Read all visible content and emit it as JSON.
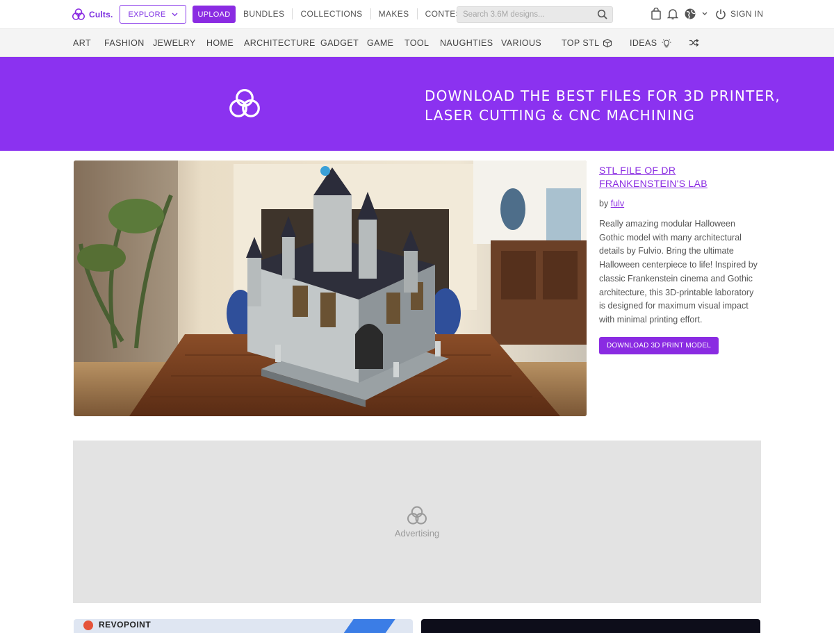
{
  "brand": {
    "logo_text": "Cults.",
    "accent": "#8a2be2"
  },
  "header": {
    "explore_label": "EXPLORE",
    "upload_label": "UPLOAD",
    "nav": [
      "BUNDLES",
      "COLLECTIONS",
      "MAKES",
      "CONTEST"
    ],
    "search_placeholder": "Search 3.6M designs...",
    "signin_label": "SIGN IN"
  },
  "categories": [
    "ART",
    "FASHION",
    "JEWELRY",
    "HOME",
    "ARCHITECTURE",
    "GADGET",
    "GAME",
    "TOOL",
    "NAUGHTIES",
    "VARIOUS",
    "TOP STL",
    "IDEAS"
  ],
  "banner": {
    "line1": "DOWNLOAD THE BEST FILES FOR 3D PRINTER,",
    "line2": "LASER CUTTING & CNC MACHINING",
    "color": "#8b32f0"
  },
  "feature": {
    "title": "STL FILE OF DR FRANKENSTEIN'S LAB",
    "by_prefix": "by",
    "author": "fulv",
    "description": "Really amazing modular Halloween Gothic model with many architectural details by Fulvio. Bring the ultimate Halloween centerpiece to life! Inspired by classic Frankenstein cinema and Gothic architecture, this 3D-printable laboratory is designed for maximum visual impact with minimal printing effort.",
    "download_label": "DOWNLOAD 3D PRINT MODEL"
  },
  "ad": {
    "label": "Advertising"
  },
  "bottom_cards": {
    "left_brand": "REVOPOINT"
  }
}
